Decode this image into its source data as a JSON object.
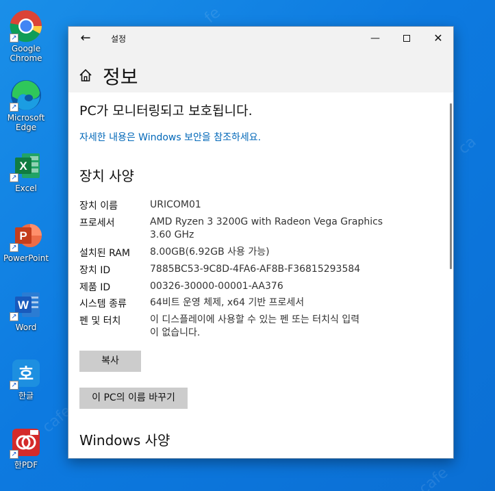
{
  "desktop": {
    "icons": [
      {
        "label_l1": "Google",
        "label_l2": "Chrome",
        "icon": "chrome-icon"
      },
      {
        "label_l1": "Microsoft",
        "label_l2": "Edge",
        "icon": "edge-icon"
      },
      {
        "label_l1": "Excel",
        "label_l2": "",
        "icon": "excel-icon"
      },
      {
        "label_l1": "PowerPoint",
        "label_l2": "",
        "icon": "powerpoint-icon"
      },
      {
        "label_l1": "Word",
        "label_l2": "",
        "icon": "word-icon"
      },
      {
        "label_l1": "한글",
        "label_l2": "",
        "icon": "hangul-icon"
      },
      {
        "label_l1": "한PDF",
        "label_l2": "",
        "icon": "hanpdf-icon"
      }
    ]
  },
  "window": {
    "app_title": "설정",
    "back_glyph": "←",
    "min_glyph": "—",
    "close_glyph": "✕",
    "page_title": "정보",
    "protect_text": "PC가 모니터링되고 보호됩니다.",
    "security_link": "자세한 내용은 Windows 보안을 참조하세요.",
    "device_spec_heading": "장치 사양",
    "specs": [
      {
        "label": "장치 이름",
        "value": "URICOM01"
      },
      {
        "label": "프로세서",
        "value": "AMD Ryzen 3 3200G with Radeon Vega Graphics",
        "value2": "3.60 GHz"
      },
      {
        "label": "설치된 RAM",
        "value": "8.00GB(6.92GB 사용 가능)"
      },
      {
        "label": "장치 ID",
        "value": "7885BC53-9C8D-4FA6-AF8B-F36815293584"
      },
      {
        "label": "제품 ID",
        "value": "00326-30000-00001-AA376"
      },
      {
        "label": "시스템 종류",
        "value": "64비트 운영 체제, x64 기반 프로세서"
      },
      {
        "label": "펜 및 터치",
        "value": "이 디스플레이에 사용할 수 있는 펜 또는 터치식 입력",
        "value2": "이 없습니다."
      }
    ],
    "copy_button": "복사",
    "rename_button": "이 PC의 이름 바꾸기",
    "windows_spec_heading": "Windows 사양"
  },
  "colors": {
    "link": "#0067b8",
    "desktop": "#0d7ae0",
    "button": "#cccccc"
  }
}
